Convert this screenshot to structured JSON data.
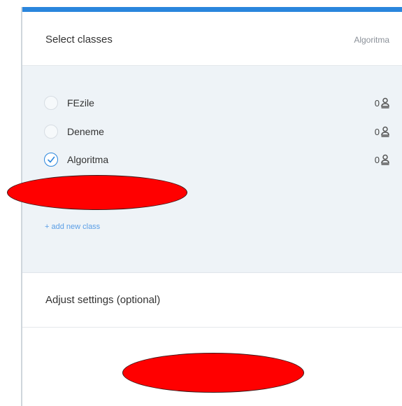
{
  "header": {
    "title": "Select classes",
    "selected_class": "Algoritma"
  },
  "classes": {
    "items": [
      {
        "name": "FEzile",
        "student_count": "0",
        "selected": false
      },
      {
        "name": "Deneme",
        "student_count": "0",
        "selected": false
      },
      {
        "name": "Algoritma",
        "student_count": "0",
        "selected": true
      }
    ],
    "add_new_label": "+ add new class"
  },
  "settings": {
    "title": "Adjust settings (optional)"
  },
  "colors": {
    "accent": "#2a86dd",
    "panel_background": "#eef3f7",
    "redaction": "#ff0000"
  },
  "icons": {
    "selected_radio": "check-circle-icon",
    "student_count": "person-icon"
  }
}
